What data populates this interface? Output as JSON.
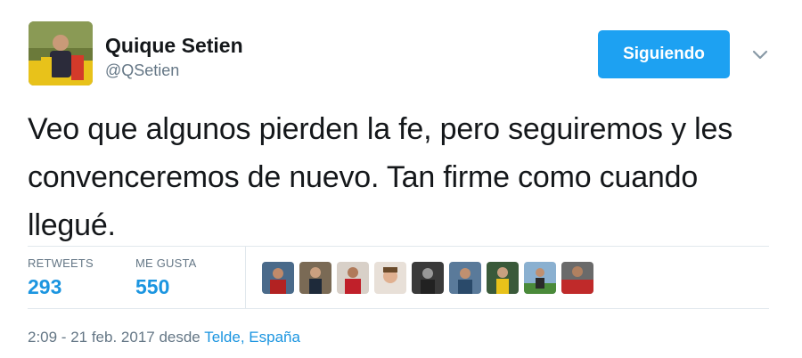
{
  "tweet": {
    "author": {
      "name": "Quique Setien",
      "handle": "@QSetien"
    },
    "follow_button": "Siguiendo",
    "menu_icon": "chevron-down-icon",
    "text": "Veo que algunos pierden la fe, pero seguiremos y les convenceremos de nuevo. Tan firme como cuando llegué.",
    "stats": {
      "retweets_label": "RETWEETS",
      "retweets_value": "293",
      "likes_label": "ME GUSTA",
      "likes_value": "550"
    },
    "meta": {
      "time_prefix": "2:09 - 21 feb. 2017 desde ",
      "location": "Telde, España"
    }
  },
  "colors": {
    "accent": "#1da1f2",
    "link": "#1b95e0",
    "secondary_text": "#657786",
    "divider": "#e1e8ed"
  }
}
